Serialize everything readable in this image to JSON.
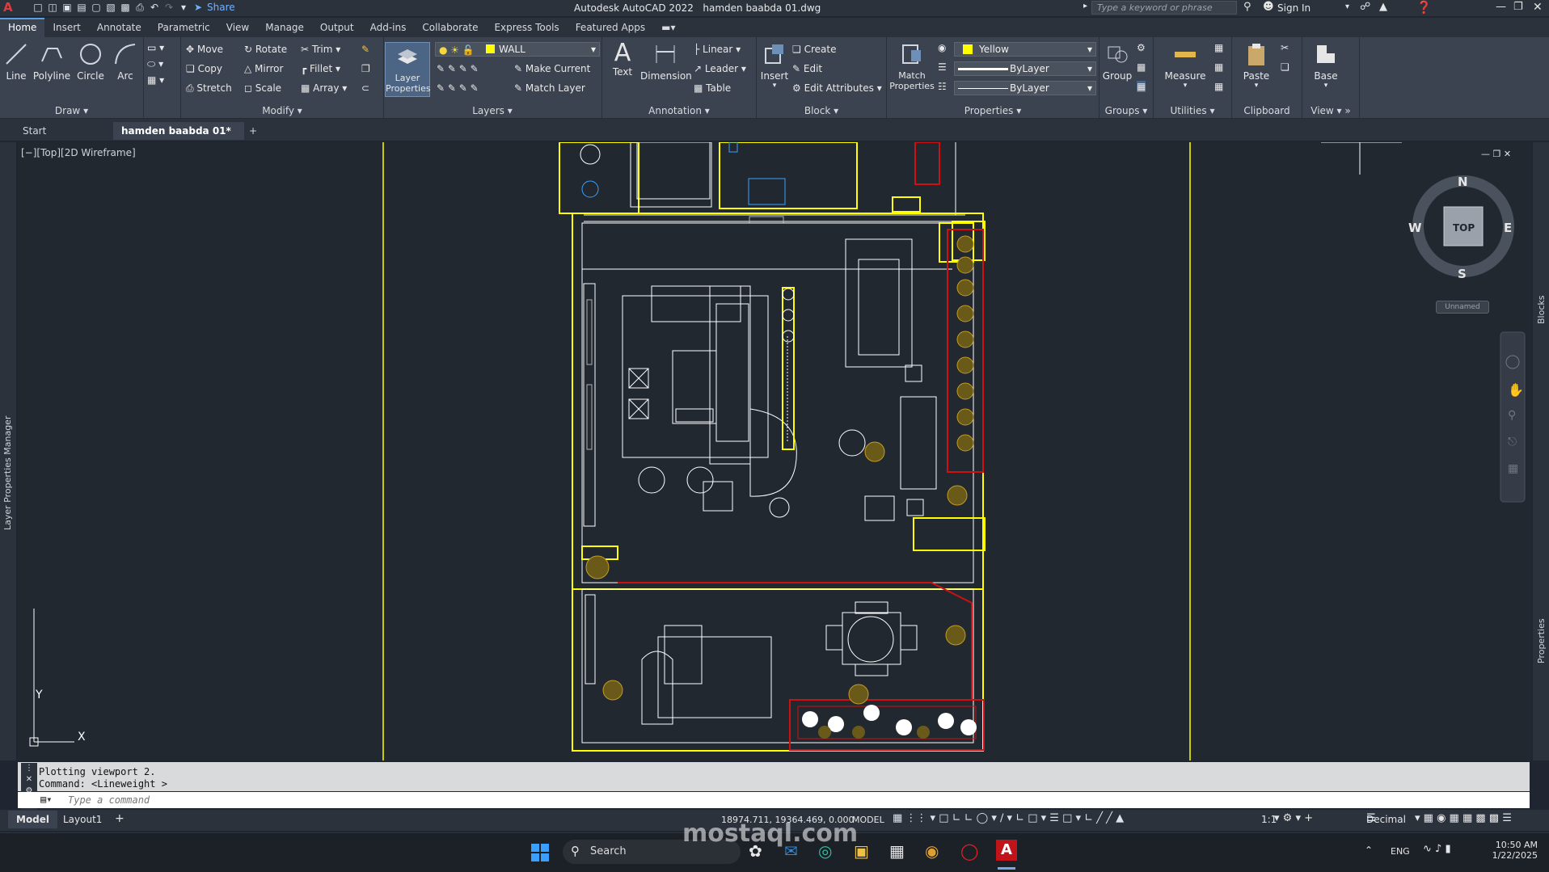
{
  "app": {
    "logo": "A",
    "title": "Autodesk AutoCAD 2022",
    "filename": "hamden baabda 01.dwg",
    "share_label": "Share",
    "search_placeholder": "Type a keyword or phrase",
    "sign_in": "Sign In"
  },
  "menu_tabs": [
    "Home",
    "Insert",
    "Annotate",
    "Parametric",
    "View",
    "Manage",
    "Output",
    "Add-ins",
    "Collaborate",
    "Express Tools",
    "Featured Apps"
  ],
  "ribbon": {
    "draw": {
      "title": "Draw",
      "line": "Line",
      "polyline": "Polyline",
      "circle": "Circle",
      "arc": "Arc"
    },
    "modify": {
      "title": "Modify",
      "move": "Move",
      "rotate": "Rotate",
      "trim": "Trim",
      "copy": "Copy",
      "mirror": "Mirror",
      "fillet": "Fillet",
      "stretch": "Stretch",
      "scale": "Scale",
      "array": "Array"
    },
    "layers": {
      "title": "Layers",
      "layer_properties": "Layer Properties",
      "current_layer": "WALL",
      "make_current": "Make Current",
      "match_layer": "Match Layer"
    },
    "annotation": {
      "title": "Annotation",
      "text": "Text",
      "dimension": "Dimension",
      "linear": "Linear",
      "leader": "Leader",
      "table": "Table"
    },
    "block": {
      "title": "Block",
      "insert": "Insert",
      "create": "Create",
      "edit": "Edit",
      "edit_attributes": "Edit Attributes"
    },
    "properties": {
      "title": "Properties",
      "match_properties": "Match Properties",
      "color": "Yellow",
      "linetype": "ByLayer",
      "lineweight": "ByLayer"
    },
    "groups": {
      "title": "Groups",
      "group": "Group"
    },
    "utilities": {
      "title": "Utilities",
      "measure": "Measure"
    },
    "clipboard": {
      "title": "Clipboard",
      "paste": "Paste"
    },
    "view": {
      "title": "View",
      "base": "Base"
    }
  },
  "file_tabs": {
    "start": "Start",
    "active": "hamden baabda 01*"
  },
  "viewport": {
    "label": "[−][Top][2D Wireframe]"
  },
  "viewcube": {
    "n": "N",
    "s": "S",
    "e": "E",
    "w": "W",
    "top": "TOP",
    "ucs": "Unnamed"
  },
  "ucs": {
    "x": "X",
    "y": "Y"
  },
  "side_panels": {
    "left": "Layer Properties Manager",
    "right_top": "Blocks",
    "right_bottom": "Properties"
  },
  "command": {
    "history": [
      "Plotting viewport 2.",
      "Command:  <Lineweight >"
    ],
    "placeholder": "Type a command"
  },
  "status": {
    "model_tab": "Model",
    "layout_tab": "Layout1",
    "coords": "18974.711, 19364.469, 0.000",
    "mode": "MODEL",
    "scale": "1:1",
    "units": "Decimal"
  },
  "taskbar": {
    "search": "Search",
    "lang": "ENG",
    "time": "10:50 AM",
    "date": "1/22/2025"
  },
  "watermark": {
    "text": "mostaql.com"
  },
  "colors": {
    "wall": "#ffff00",
    "red": "#d01010",
    "bg": "#212830",
    "ribbon": "#3b4350",
    "accent": "#5aa0e0"
  }
}
